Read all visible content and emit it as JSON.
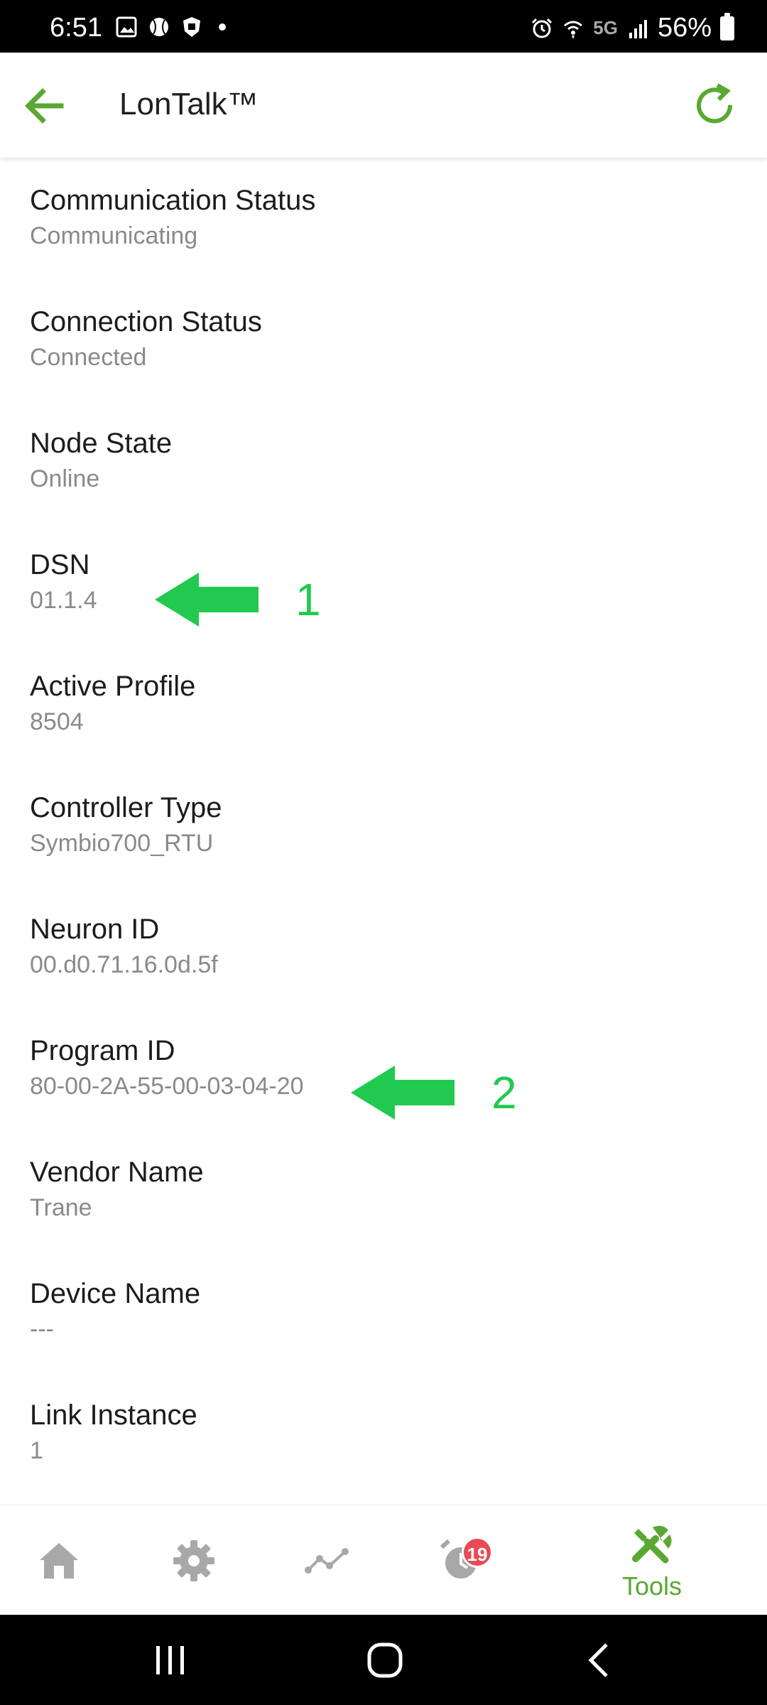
{
  "status_bar": {
    "time": "6:51",
    "network": "5G",
    "battery": "56%"
  },
  "app_bar": {
    "title": "LonTalk™"
  },
  "items": [
    {
      "label": "Communication Status",
      "value": "Communicating"
    },
    {
      "label": "Connection Status",
      "value": "Connected"
    },
    {
      "label": "Node State",
      "value": "Online"
    },
    {
      "label": "DSN",
      "value": "01.1.4"
    },
    {
      "label": "Active Profile",
      "value": "8504"
    },
    {
      "label": "Controller Type",
      "value": "Symbio700_RTU"
    },
    {
      "label": "Neuron ID",
      "value": "00.d0.71.16.0d.5f"
    },
    {
      "label": "Program ID",
      "value": "80-00-2A-55-00-03-04-20"
    },
    {
      "label": "Vendor Name",
      "value": "Trane"
    },
    {
      "label": "Device Name",
      "value": "---"
    },
    {
      "label": "Link Instance",
      "value": "1"
    }
  ],
  "annotations": {
    "first": "1",
    "second": "2"
  },
  "bottom_nav": {
    "alarms_badge": "19",
    "tools_label": "Tools"
  },
  "colors": {
    "accent": "#5aa832",
    "annotation": "#22c94f",
    "inactive_icon": "#a8a8a8",
    "badge": "#e84b55"
  }
}
